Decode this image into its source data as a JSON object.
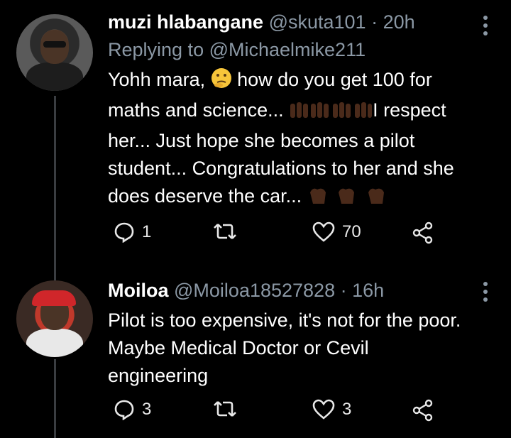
{
  "tweets": [
    {
      "name": "muzi hlabangane",
      "handle": "@skuta101",
      "separator": "·",
      "time": "20h",
      "replying_prefix": "Replying to",
      "replying_handle": "@Michaelmike211",
      "text_parts": [
        "Yohh mara, ",
        " how do you get 100 for maths and science... ",
        "I respect her... Just hope she becomes a pilot student... Congratulations to her and she does deserve the car... "
      ],
      "replies": "1",
      "retweets": "",
      "likes": "70",
      "icons": {
        "thinking": "thinking-face-emoji",
        "hands": "raised-hands-emoji",
        "wave": "clapping-hands-emoji"
      }
    },
    {
      "name": "Moiloa",
      "handle": "@Moiloa18527828",
      "separator": "·",
      "time": "16h",
      "text": "Pilot is too expensive, it's not for the poor. Maybe Medical Doctor or Cevil engineering",
      "replies": "3",
      "retweets": "",
      "likes": "3"
    }
  ],
  "colors": {
    "background": "#000000",
    "muted": "#8b98a5",
    "thread_line": "#3a3d41"
  }
}
